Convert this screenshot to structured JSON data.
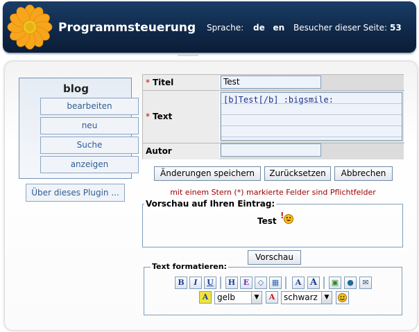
{
  "header": {
    "title": "Programmsteuerung",
    "language_label": "Sprache:",
    "languages": [
      "de",
      "en"
    ],
    "visitors_label": "Besucher dieser Seite:",
    "visitors_count": "53"
  },
  "sidebar": {
    "title": "blog",
    "items": [
      "bearbeiten",
      "neu",
      "Suche",
      "anzeigen"
    ],
    "plugin_button": "Über dieses Plugin ..."
  },
  "form": {
    "title_label": "Titel",
    "title_value": "Test",
    "text_label": "Text",
    "text_value": "[b]Test[/b] :bigsmile:",
    "author_label": "Autor",
    "author_value": "",
    "required_marker": "*"
  },
  "buttons": {
    "save": "Änderungen speichern",
    "reset": "Zurücksetzen",
    "cancel": "Abbrechen",
    "preview": "Vorschau"
  },
  "required_note": "mit einem Stern (*) markierte Felder sind Pflichtfelder",
  "preview": {
    "legend": "Vorschau auf Ihren Eintrag:",
    "text": "Test"
  },
  "format": {
    "legend": "Text formatieren:",
    "toolbar": [
      {
        "glyph": "B",
        "icon": "bold-icon"
      },
      {
        "glyph": "I",
        "icon": "italic-icon"
      },
      {
        "glyph": "U",
        "icon": "underline-icon"
      },
      {
        "glyph": "H",
        "icon": "heading-icon"
      },
      {
        "glyph": "E",
        "icon": "emphasis-icon"
      },
      {
        "glyph": "◇",
        "icon": "code-icon"
      },
      {
        "glyph": "▦",
        "icon": "list-icon"
      },
      {
        "glyph": "A",
        "icon": "font-bigger-icon"
      },
      {
        "glyph": "A",
        "icon": "font-smaller-icon"
      },
      {
        "glyph": "▣",
        "icon": "image-icon"
      },
      {
        "glyph": "●",
        "icon": "link-icon"
      },
      {
        "glyph": "✉",
        "icon": "email-icon"
      }
    ],
    "background_color": "gelb",
    "text_color": "schwarz"
  },
  "colors": {
    "header_bg": "#10294a",
    "link_blue": "#2f5c92",
    "required_red": "#c00000"
  }
}
